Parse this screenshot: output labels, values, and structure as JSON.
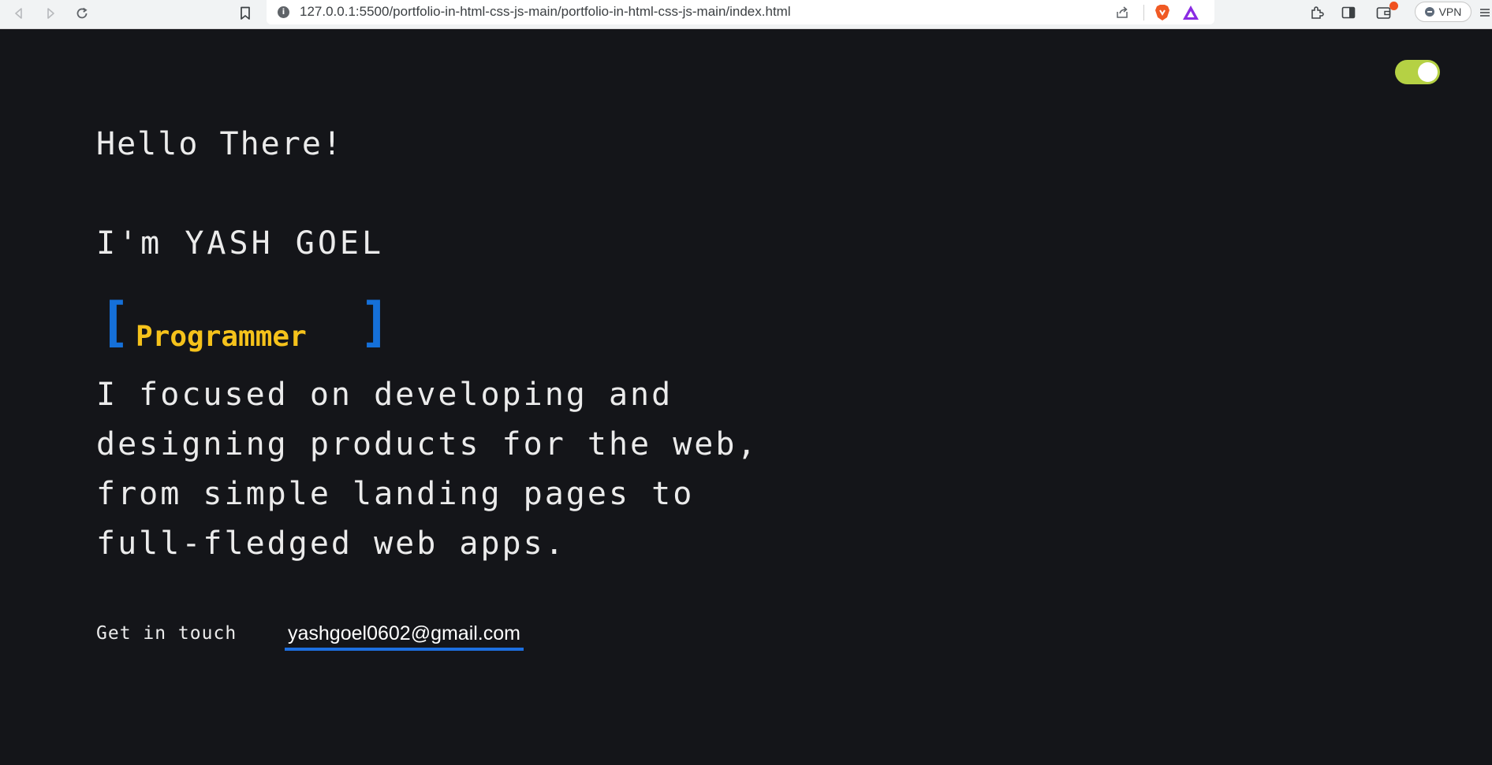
{
  "browser": {
    "url": "127.0.0.1:5500/portfolio-in-html-css-js-main/portfolio-in-html-css-js-main/index.html",
    "vpn_label": "VPN",
    "icons": [
      "back-icon",
      "forward-icon",
      "reload-icon",
      "bookmark-icon",
      "site-info-icon",
      "share-icon",
      "brave-shield-icon",
      "brave-rewards-icon",
      "extensions-icon",
      "sidebar-icon",
      "wallet-icon",
      "menu-icon"
    ]
  },
  "theme_toggle": {
    "state": "on",
    "color": "#b5d144"
  },
  "hero": {
    "greeting": "Hello There!",
    "intro": "I'm YASH GOEL",
    "bracket_open": "[",
    "bracket_close": "]",
    "role": "Programmer",
    "bio": "I focused on developing and designing products for the web, from simple landing pages to full-fledged web apps."
  },
  "contact": {
    "label": "Get in touch",
    "email": "yashgoel0602@gmail.com"
  },
  "colors": {
    "background": "#141519",
    "text": "#ebebeb",
    "accent_yellow": "#f5c21b",
    "accent_blue": "#1570d9"
  }
}
